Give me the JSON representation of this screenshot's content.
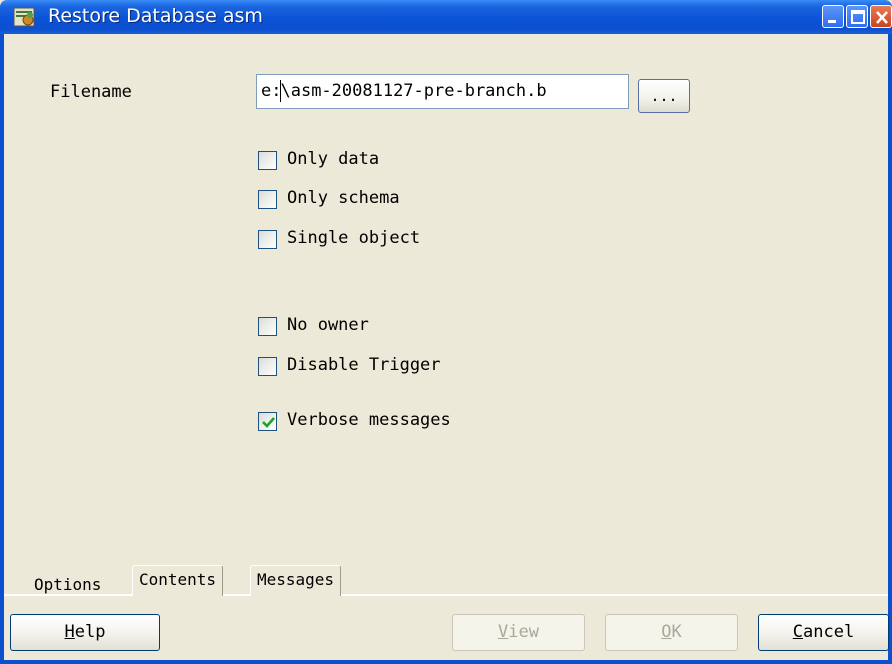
{
  "window": {
    "title": "Restore Database asm"
  },
  "form": {
    "filename_label": "Filename",
    "filename_value_prefix": "e:",
    "filename_value_rest": "\\asm-20081127-pre-branch.b",
    "browse_label": "..."
  },
  "options": [
    {
      "label": "Only data",
      "checked": false
    },
    {
      "label": "Only schema",
      "checked": false
    },
    {
      "label": "Single object",
      "checked": false
    },
    {
      "label": "No owner",
      "checked": false
    },
    {
      "label": "Disable Trigger",
      "checked": false
    },
    {
      "label": "Verbose messages",
      "checked": true
    }
  ],
  "tabs": [
    {
      "label": "Options",
      "active": true
    },
    {
      "label": "Contents",
      "active": false
    },
    {
      "label": "Messages",
      "active": false
    }
  ],
  "buttons": {
    "help": {
      "mnemonic": "H",
      "rest": "elp",
      "enabled": true
    },
    "view": {
      "mnemonic": "V",
      "rest": "iew",
      "enabled": false
    },
    "ok": {
      "mnemonic": "O",
      "rest": "K",
      "enabled": false
    },
    "cancel": {
      "mnemonic": "C",
      "rest": "ancel",
      "enabled": true
    }
  },
  "colors": {
    "titlebar": "#0a53d8",
    "window_bg": "#ece9d8",
    "check_mark": "#21a121"
  }
}
